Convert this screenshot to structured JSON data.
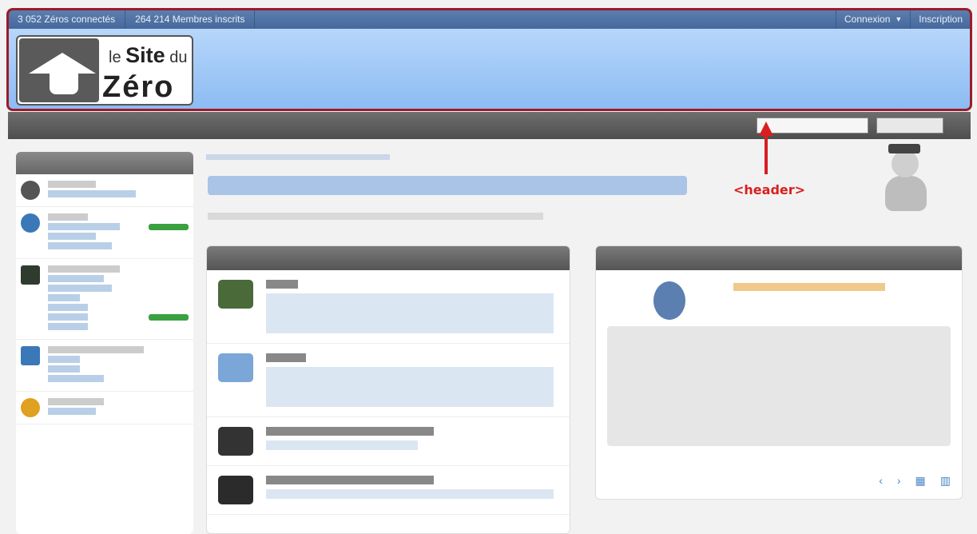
{
  "topbar": {
    "online": "3 052 Zéros connectés",
    "members": "264 214 Membres inscrits",
    "login": "Connexion",
    "signup": "Inscription"
  },
  "logo": {
    "line1_small": "le",
    "line1_big": "Site",
    "line1_tail": "du",
    "line2": "Zéro"
  },
  "annotation": {
    "label": "<header>",
    "color": "#d81f1f"
  },
  "colors": {
    "highlight_border": "#9b1b2a",
    "header_band": "#8cbcf3",
    "topbar": "#46689a"
  }
}
